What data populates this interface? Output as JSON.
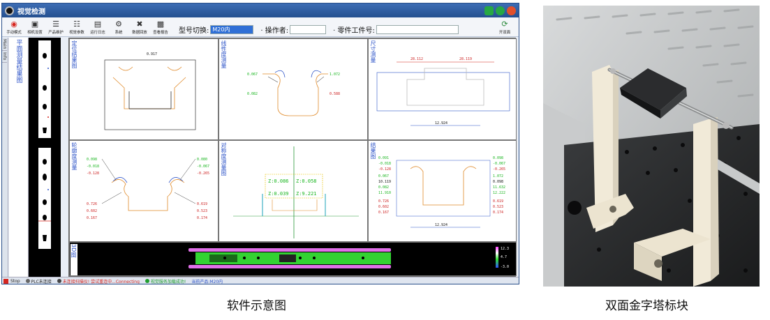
{
  "app": {
    "title": "视觉检测",
    "toolbar": {
      "buttons": [
        {
          "icon": "stop-icon",
          "label": "手动模式"
        },
        {
          "icon": "camera-icon",
          "label": "相机设置"
        },
        {
          "icon": "layers-icon",
          "label": "产品维护"
        },
        {
          "icon": "sliders-icon",
          "label": "视觉参数"
        },
        {
          "icon": "log-icon",
          "label": "运行日志"
        },
        {
          "icon": "gear-icon",
          "label": "系统"
        },
        {
          "icon": "tools-icon",
          "label": "数据回放"
        },
        {
          "icon": "report-icon",
          "label": "查看报告"
        }
      ],
      "model_switch_label": "型号切换:",
      "model_switch_value": "M20内",
      "operator_label": "· 操作者:",
      "operator_value": "",
      "part_number_label": "· 零件工件号:",
      "part_number_value": "",
      "open_door_label": "开双面"
    },
    "side_tabs": [
      "Main",
      "Info"
    ],
    "side_title": "平面测量结果图",
    "cells": [
      {
        "title": "定位结果图"
      },
      {
        "title": "线性度测量"
      },
      {
        "title": "尺寸测量"
      },
      {
        "title": "轮廓度测量"
      },
      {
        "title": "对称度测量图"
      },
      {
        "title": "结果图"
      },
      {
        "title": "3D图"
      }
    ],
    "measurements": {
      "locate_top": "0.917",
      "linear_left_top": "0.067",
      "linear_left_bottom": "0.082",
      "linear_right_top": "1.072",
      "linear_right_bottom": "0.588",
      "size_top_left": "28.112",
      "size_top_right": "28.119",
      "size_bottom": "12.924",
      "contour_left": [
        "0.098",
        "-0.018",
        "-0.128",
        "0.726",
        "0.602",
        "0.167"
      ],
      "contour_right": [
        "0.080",
        "-0.067",
        "-0.265",
        "0.619",
        "0.523",
        "0.174"
      ],
      "sym_z1": "Z:0.086",
      "sym_z2": "Z:0.058",
      "sym_z3": "Z:0.039",
      "sym_z4": "Z:9.221",
      "result_left": [
        "0.091",
        "-0.018",
        "-0.128",
        "0.067",
        "10.119",
        "0.082",
        "11.910",
        "0.726",
        "0.602",
        "0.167"
      ],
      "result_right": [
        "0.098",
        "-0.067",
        "-0.265",
        "1.072",
        "0.098",
        "11.632",
        "12.222",
        "0.619",
        "0.523",
        "0.174"
      ],
      "result_bottom": "12.924",
      "scale_max": "12.3",
      "scale_mid": "4.7",
      "scale_min": "-3.0"
    },
    "status": {
      "stop": "Stop",
      "plc": "PLC未连接",
      "scan": "未连接扫描仪! 尝试重连中...Connecting",
      "vision": "视觉服务加载成功!",
      "product": "当前产品:M20内"
    }
  },
  "captions": {
    "left": "软件示意图",
    "right": "双面金字塔标块"
  }
}
